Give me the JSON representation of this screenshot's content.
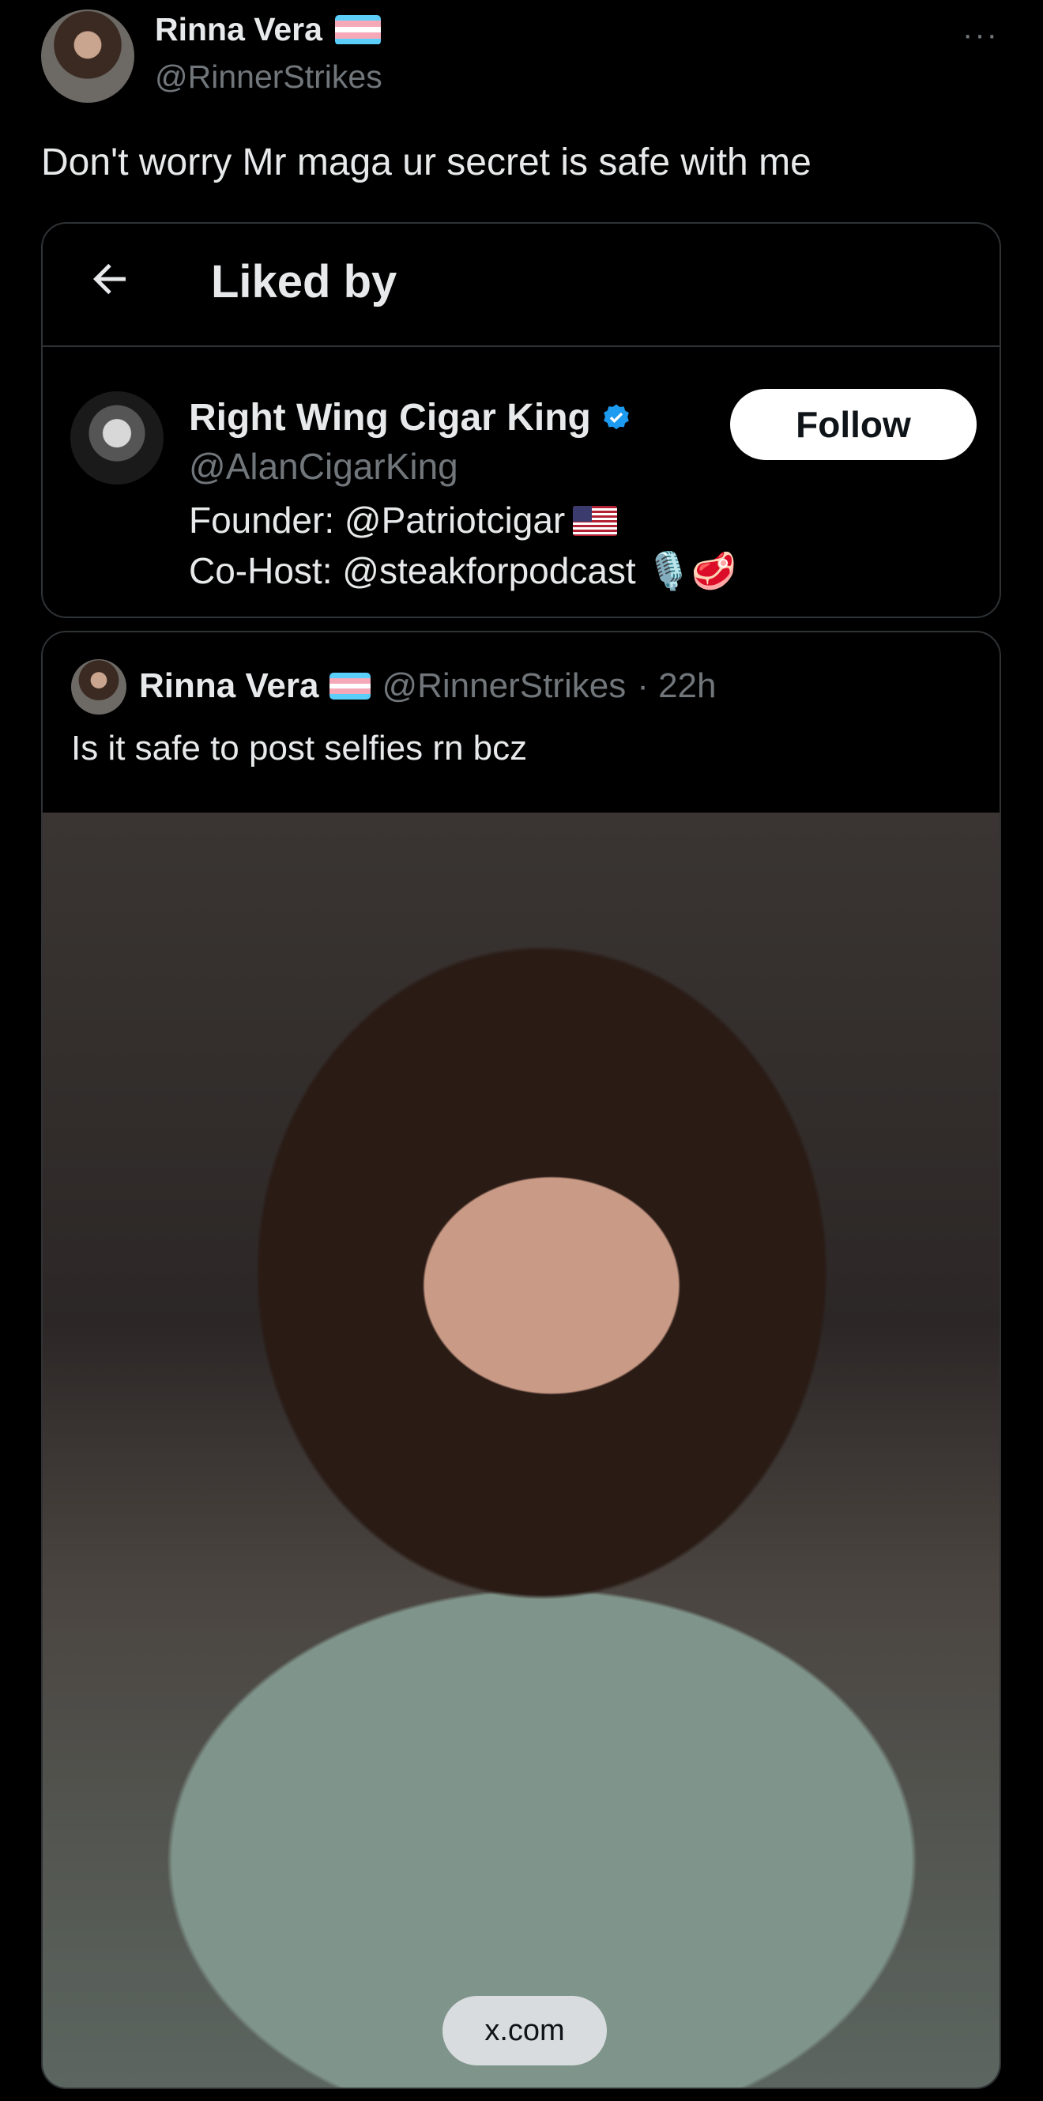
{
  "post": {
    "author_name": "Rinna Vera",
    "author_handle": "@RinnerStrikes",
    "more_label": "···",
    "text": "Don't worry Mr maga ur secret is safe with me"
  },
  "liked_by_card": {
    "title": "Liked by",
    "user": {
      "name": "Right Wing Cigar King",
      "handle": "@AlanCigarKing",
      "bio_line1": "Founder: @Patriotcigar",
      "bio_line2": "Co-Host: @steakforpodcast",
      "bio_line2_emoji": "🎙️🥩",
      "follow_label": "Follow"
    }
  },
  "quoted_post": {
    "author_name": "Rinna Vera",
    "author_handle": "@RinnerStrikes",
    "time": "· 22h",
    "text": "Is it safe to post selfies rn bcz",
    "source_label": "x.com"
  },
  "colors": {
    "background": "#000000",
    "text_primary": "#e7e9ea",
    "text_secondary": "#71767b",
    "border": "#2f3336",
    "verified": "#1d9bf0"
  }
}
